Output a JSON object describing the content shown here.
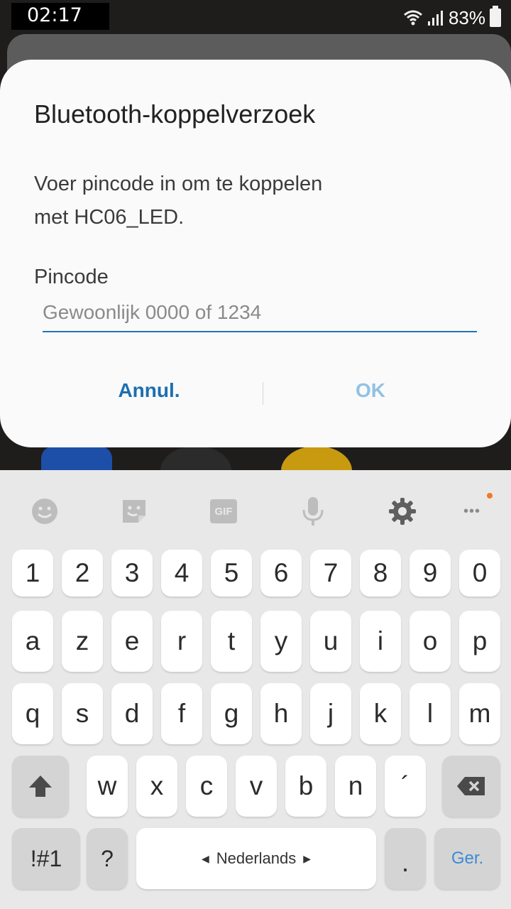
{
  "status_bar": {
    "time": "02:17",
    "battery": "83%"
  },
  "dialog": {
    "title": "Bluetooth-koppelverzoek",
    "message_line1": "Voer pincode in om te koppelen",
    "message_line2": "met HC06_LED.",
    "pin_label": "Pincode",
    "pin_placeholder": "Gewoonlijk 0000 of 1234",
    "cancel_label": "Annul.",
    "ok_label": "OK"
  },
  "keyboard": {
    "toolbar": [
      "emoji-icon",
      "sticker-icon",
      "gif-icon",
      "microphone-icon",
      "settings-icon",
      "more-icon"
    ],
    "gif_label": "GIF",
    "more_label": "•••",
    "row_numbers": [
      "1",
      "2",
      "3",
      "4",
      "5",
      "6",
      "7",
      "8",
      "9",
      "0"
    ],
    "row1": [
      "a",
      "z",
      "e",
      "r",
      "t",
      "y",
      "u",
      "i",
      "o",
      "p"
    ],
    "row2": [
      "q",
      "s",
      "d",
      "f",
      "g",
      "h",
      "j",
      "k",
      "l",
      "m"
    ],
    "row3": [
      "w",
      "x",
      "c",
      "v",
      "b",
      "n",
      "´"
    ],
    "symbols_label": "!#1",
    "question_label": "?",
    "language_label": "Nederlands",
    "period_label": ".",
    "enter_label": "Ger."
  },
  "colors": {
    "accent": "#1c6fb0",
    "ok_disabled": "#90c2e4",
    "enter": "#3d8ad6"
  }
}
